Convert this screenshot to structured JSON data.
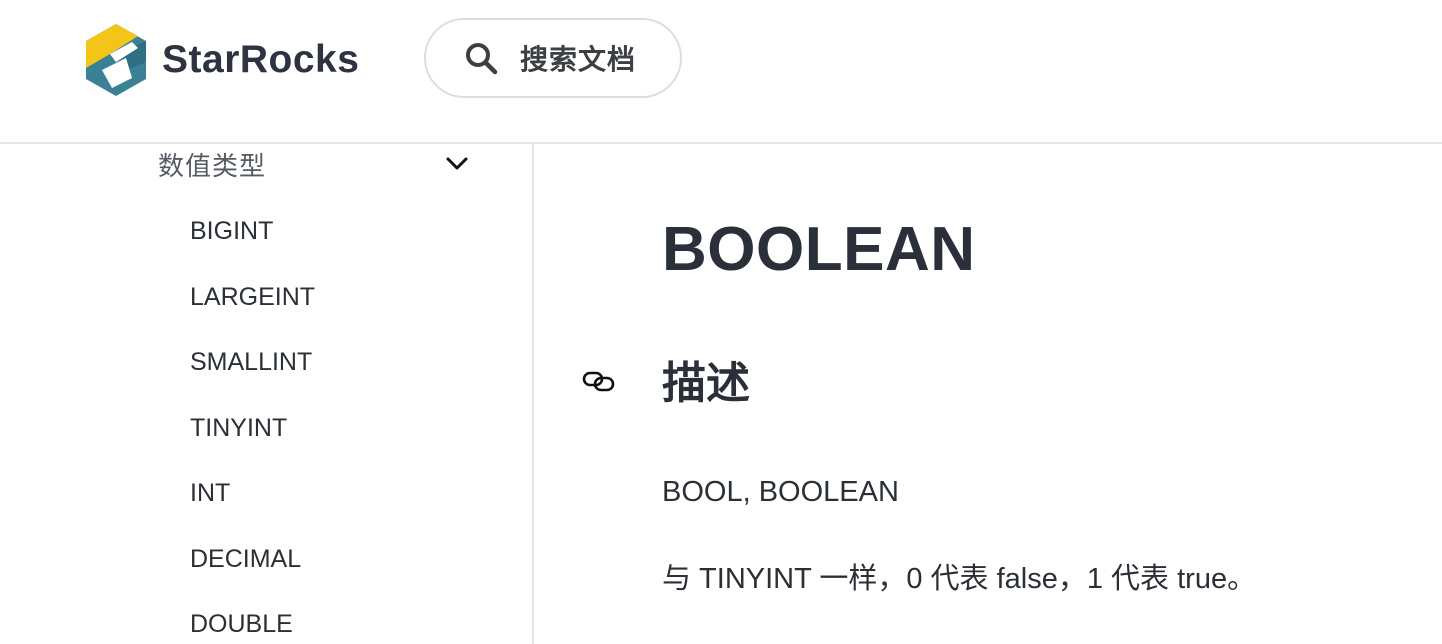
{
  "header": {
    "logo_text": "StarRocks",
    "search_label": "搜索文档"
  },
  "sidebar": {
    "category": "数值类型",
    "items": [
      "BIGINT",
      "LARGEINT",
      "SMALLINT",
      "TINYINT",
      "INT",
      "DECIMAL",
      "DOUBLE"
    ]
  },
  "content": {
    "title": "BOOLEAN",
    "section_title": "描述",
    "paragraphs": [
      "BOOL, BOOLEAN",
      "与 TINYINT 一样，0 代表 false，1 代表 true。"
    ]
  },
  "colors": {
    "logo_yellow": "#f5c418",
    "logo_teal": "#3a8196",
    "text_dark": "#2b2f3a"
  }
}
